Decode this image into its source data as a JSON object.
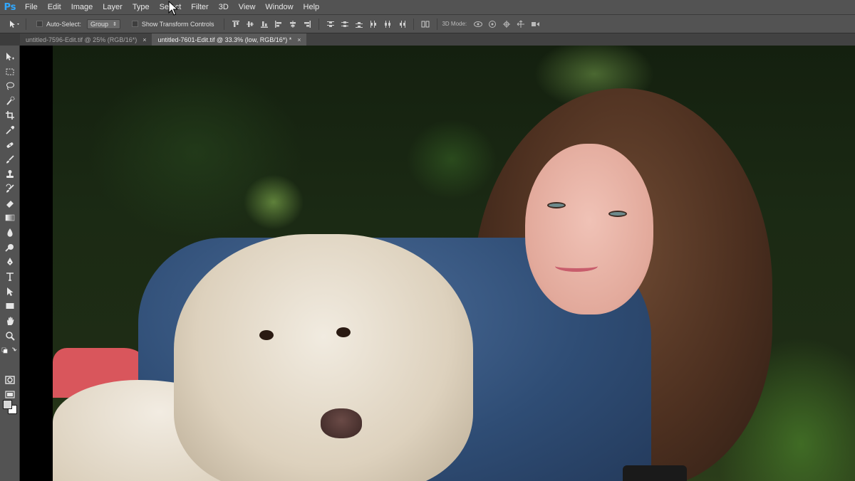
{
  "app": {
    "logo": "Ps"
  },
  "menu": [
    "File",
    "Edit",
    "Image",
    "Layer",
    "Type",
    "Select",
    "Filter",
    "3D",
    "View",
    "Window",
    "Help"
  ],
  "options": {
    "auto_select_label": "Auto-Select:",
    "auto_select_value": "Group",
    "transform_label": "Show Transform Controls",
    "mode_3d_label": "3D Mode:"
  },
  "tabs": [
    {
      "label": "untitled-7596-Edit.tif @ 25% (RGB/16*)",
      "close": "×"
    },
    {
      "label": "untitled-7601-Edit.tif @ 33.3% (low, RGB/16*) *",
      "close": "×"
    }
  ],
  "tools": [
    "move-tool-icon",
    "marquee-tool-icon",
    "lasso-tool-icon",
    "quick-select-tool-icon",
    "crop-tool-icon",
    "eyedropper-tool-icon",
    "healing-brush-tool-icon",
    "brush-tool-icon",
    "clone-stamp-tool-icon",
    "history-brush-tool-icon",
    "eraser-tool-icon",
    "gradient-tool-icon",
    "blur-tool-icon",
    "dodge-tool-icon",
    "pen-tool-icon",
    "type-tool-icon",
    "path-select-tool-icon",
    "rectangle-tool-icon",
    "hand-tool-icon",
    "zoom-tool-icon"
  ],
  "colors": {
    "foreground": "#d7d7d7",
    "background": "#ffffff",
    "accent": "#31a8ff"
  }
}
